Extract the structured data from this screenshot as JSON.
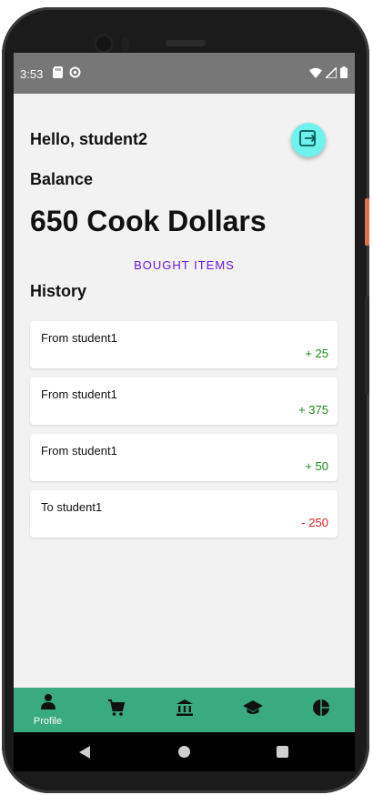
{
  "status_bar": {
    "time": "3:53",
    "left_icons": [
      "sd-card-icon",
      "sync-icon"
    ],
    "right_icons": [
      "wifi-icon",
      "signal-icon",
      "battery-icon"
    ]
  },
  "profile": {
    "greeting": "Hello, student2",
    "balance_label": "Balance",
    "balance_value": "650 Cook Dollars",
    "bought_items_label": "BOUGHT ITEMS",
    "history_label": "History",
    "logout_icon": "logout-icon"
  },
  "history": [
    {
      "party": "From student1",
      "amount": "+ 25",
      "kind": "credit"
    },
    {
      "party": "From student1",
      "amount": "+ 375",
      "kind": "credit"
    },
    {
      "party": "From student1",
      "amount": "+ 50",
      "kind": "credit"
    },
    {
      "party": "To student1",
      "amount": "- 250",
      "kind": "debit"
    }
  ],
  "bottom_nav": {
    "items": [
      {
        "icon": "person-icon",
        "label": "Profile"
      },
      {
        "icon": "cart-icon",
        "label": ""
      },
      {
        "icon": "bank-icon",
        "label": ""
      },
      {
        "icon": "graduation-cap-icon",
        "label": ""
      },
      {
        "icon": "pie-chart-icon",
        "label": ""
      }
    ]
  },
  "colors": {
    "accent_nav": "#3aaa80",
    "fab": "#6ff2ec",
    "link": "#6a16e0",
    "credit": "#1a8a1a",
    "debit": "#e02020",
    "status_bar": "#777777"
  }
}
